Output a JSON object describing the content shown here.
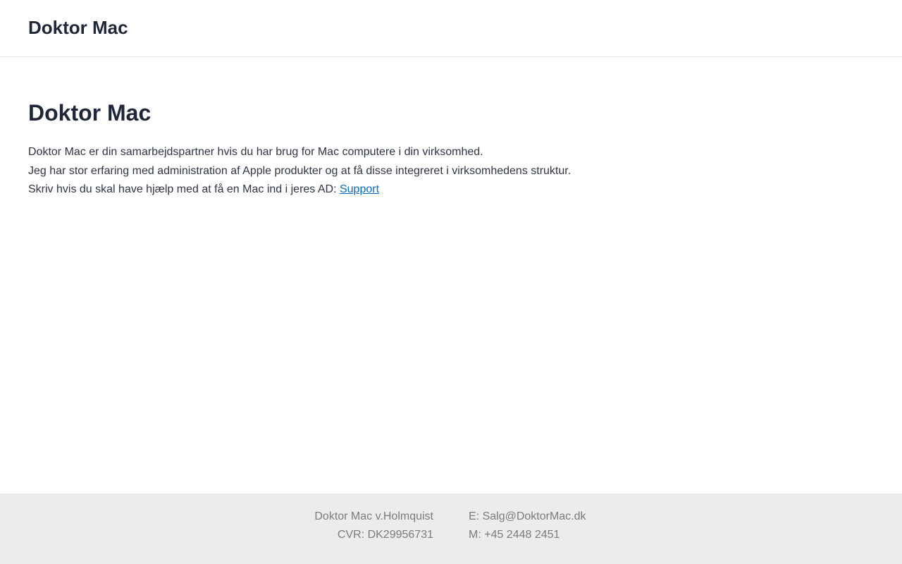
{
  "header": {
    "site_title": "Doktor Mac"
  },
  "main": {
    "title": "Doktor Mac",
    "paragraph_lines": [
      "Doktor Mac er din samarbejdspartner hvis du har brug for Mac computere i din virksomhed.",
      "Jeg har stor erfaring med administration af Apple produkter og at få disse integreret i virksomhedens struktur.",
      "Skriv hvis du skal have hjælp med at få en Mac ind i jeres AD: "
    ],
    "support_link": "Support"
  },
  "footer": {
    "company": "Doktor Mac v.Holmquist",
    "cvr": "CVR: DK29956731",
    "email": "E: Salg@DoktorMac.dk",
    "phone": "M: +45 2448 2451"
  },
  "colors": {
    "heading": "#1e2638",
    "body_text": "#2f3544",
    "link": "#0a6cbd",
    "footer_bg": "#ececec",
    "footer_text": "#7b7b7b",
    "header_border": "#e3e3e3"
  }
}
